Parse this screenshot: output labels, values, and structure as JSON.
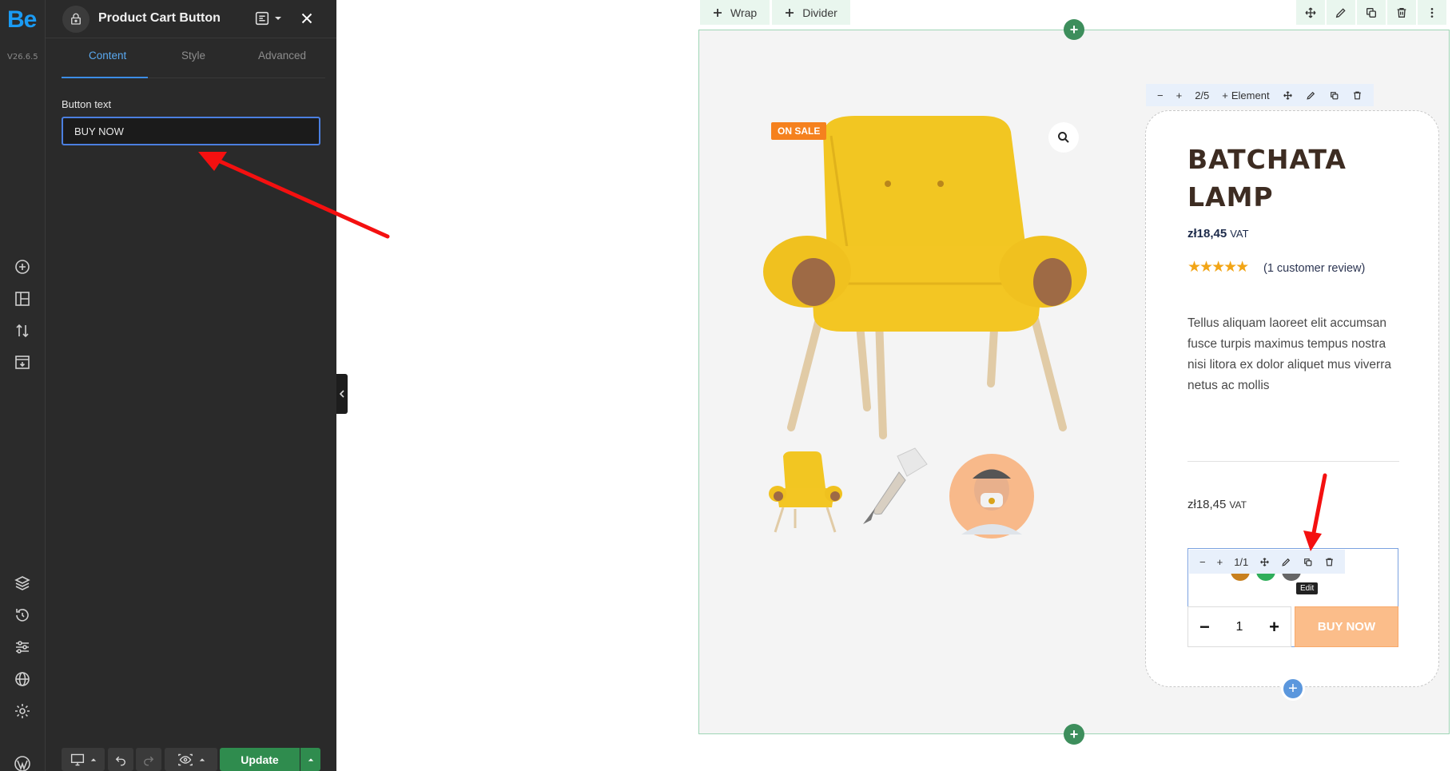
{
  "app": {
    "logo": "Be",
    "version": "V26.6.5"
  },
  "panel": {
    "title": "Product Cart Button",
    "tabs": [
      {
        "label": "Content"
      },
      {
        "label": "Style"
      },
      {
        "label": "Advanced"
      }
    ],
    "field_label": "Button text",
    "field_value": "BUY NOW",
    "update_label": "Update"
  },
  "canvas": {
    "section_toolbar": {
      "wrap": "Wrap",
      "divider": "Divider"
    },
    "column_toolbar": {
      "size": "2/5",
      "element": "Element"
    },
    "badge": "ON SALE",
    "product": {
      "title": "BATCHATA LAMP",
      "price": "zł18,45",
      "vat": "VAT",
      "stars": "★★★★★",
      "review": "(1 customer review)",
      "description": "Tellus aliquam laoreet elit accumsan fusce turpis maximus tempus nostra nisi litora ex dolor aliquet mus viverra netus ac mollis",
      "price2": "zł18,45",
      "vat2": "VAT",
      "quantity": "1",
      "buy_label": "BUY NOW"
    },
    "element_toolbar": {
      "size": "1/1",
      "tooltip": "Edit"
    }
  },
  "colors": {
    "accent": "#3c8de6",
    "update": "#2f8c4e",
    "buy": "#fbbd8a",
    "sale": "#f5811e",
    "arrow": "#f41010"
  }
}
